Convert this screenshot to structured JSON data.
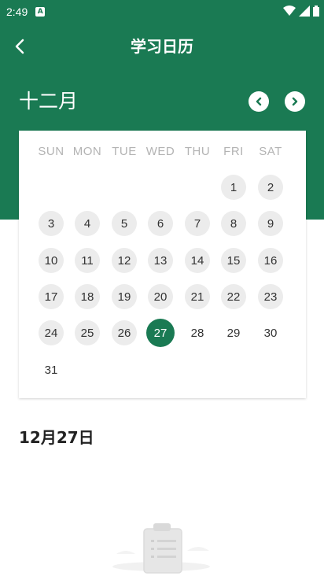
{
  "status": {
    "time": "2:49",
    "app_badge": "A"
  },
  "header": {
    "title": "学习日历"
  },
  "calendar": {
    "month_label": "十二月",
    "weekdays": [
      "SUN",
      "MON",
      "TUE",
      "WED",
      "THU",
      "FRI",
      "SAT"
    ],
    "weeks": [
      [
        "",
        "",
        "",
        "",
        "",
        "1",
        "2"
      ],
      [
        "3",
        "4",
        "5",
        "6",
        "7",
        "8",
        "9"
      ],
      [
        "10",
        "11",
        "12",
        "13",
        "14",
        "15",
        "16"
      ],
      [
        "17",
        "18",
        "19",
        "20",
        "21",
        "22",
        "23"
      ],
      [
        "24",
        "25",
        "26",
        "27",
        "28",
        "29",
        "30"
      ],
      [
        "31",
        "",
        "",
        "",
        "",
        "",
        ""
      ]
    ],
    "selected_day": "27",
    "no_background_days": [
      "28",
      "29",
      "30",
      "31"
    ]
  },
  "selected_date_label": "12月27日",
  "colors": {
    "primary": "#1a7a53",
    "day_bg": "#ececec",
    "weekday": "#b3b3b3"
  },
  "icons": {
    "back": "back-arrow-icon",
    "prev": "chevron-left-icon",
    "next": "chevron-right-icon",
    "empty": "clipboard-icon"
  }
}
